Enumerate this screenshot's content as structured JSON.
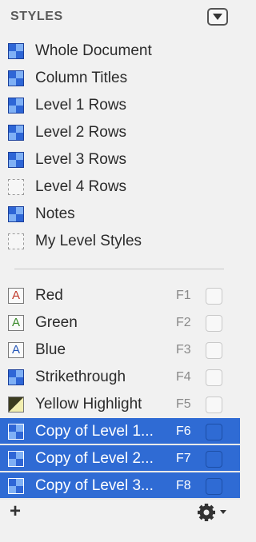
{
  "header": {
    "title": "STYLES"
  },
  "named_styles": [
    {
      "label": "Whole Document",
      "icon": "style-icon"
    },
    {
      "label": "Column Titles",
      "icon": "style-icon"
    },
    {
      "label": "Level 1 Rows",
      "icon": "style-icon"
    },
    {
      "label": "Level 2 Rows",
      "icon": "style-icon"
    },
    {
      "label": "Level 3 Rows",
      "icon": "style-icon"
    },
    {
      "label": "Level 4 Rows",
      "icon": "empty-style-icon"
    },
    {
      "label": "Notes",
      "icon": "style-icon"
    },
    {
      "label": "My Level Styles",
      "icon": "empty-style-icon"
    }
  ],
  "custom_styles": [
    {
      "label": "Red",
      "key": "F1",
      "icon": "letter-a-icon",
      "icon_letter": "A",
      "icon_color": "#c0392b",
      "selected": false
    },
    {
      "label": "Green",
      "key": "F2",
      "icon": "letter-a-icon",
      "icon_letter": "A",
      "icon_color": "#3a8a2a",
      "selected": false
    },
    {
      "label": "Blue",
      "key": "F3",
      "icon": "letter-a-icon",
      "icon_letter": "A",
      "icon_color": "#2456b8",
      "selected": false
    },
    {
      "label": "Strikethrough",
      "key": "F4",
      "icon": "style-icon",
      "selected": false
    },
    {
      "label": "Yellow Highlight",
      "key": "F5",
      "icon": "highlight-icon",
      "selected": false
    },
    {
      "label": "Copy of Level 1...",
      "key": "F6",
      "icon": "style-icon",
      "selected": true
    },
    {
      "label": "Copy of Level 2...",
      "key": "F7",
      "icon": "style-icon",
      "selected": true
    },
    {
      "label": "Copy of Level 3...",
      "key": "F8",
      "icon": "style-icon",
      "selected": true
    }
  ],
  "footer": {
    "add_label": "+",
    "gear_icon": "gear-icon"
  },
  "colors": {
    "selection": "#2f6bd4",
    "background": "#f1f1f1"
  }
}
